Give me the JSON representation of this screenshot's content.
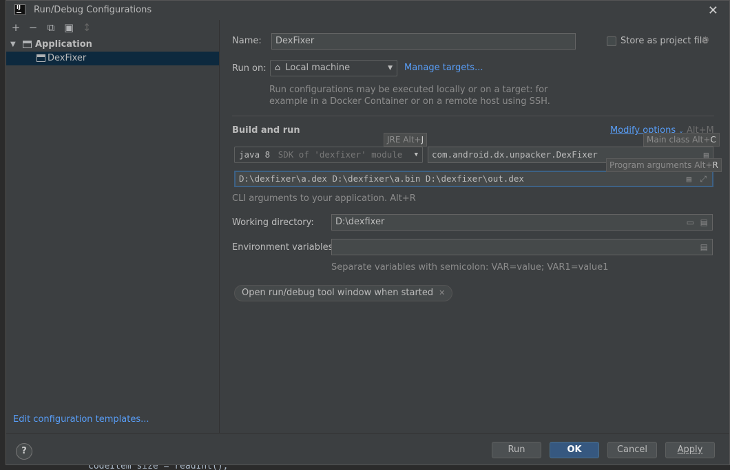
{
  "window": {
    "title": "Run/Debug Configurations"
  },
  "background": {
    "code_line": "codeItem_size = readInt();"
  },
  "toolbar": {
    "add": "+",
    "remove": "−",
    "copy": "⧉",
    "move_to_folder": "▣",
    "sort": "↕"
  },
  "tree": {
    "group_label": "Application",
    "item_label": "DexFixer"
  },
  "edit_templates_link": "Edit configuration templates...",
  "form": {
    "name_label": "Name:",
    "name_value": "DexFixer",
    "store_label": "Store as project file",
    "run_on_label": "Run on:",
    "run_on_value": "Local machine",
    "manage_targets": "Manage targets...",
    "run_on_hint_line1": "Run configurations may be executed locally or on a target: for",
    "run_on_hint_line2": "example in a Docker Container or on a remote host using SSH.",
    "section_title": "Build and run",
    "modify_options": "Modify options",
    "modify_options_shortcut": "Alt+M",
    "jre_tooltip_prefix": "JRE Alt+",
    "jre_tooltip_key": "J",
    "jre_value": "java 8",
    "jre_hint": "SDK of 'dexfixer' module",
    "main_class_tooltip_prefix": "Main class Alt+",
    "main_class_tooltip_key": "C",
    "main_class_value": "com.android.dx.unpacker.DexFixer",
    "program_args_tooltip_prefix": "Program arguments Alt+",
    "program_args_tooltip_key": "R",
    "program_args_value": "D:\\dexfixer\\a.dex D:\\dexfixer\\a.bin D:\\dexfixer\\out.dex",
    "cli_hint": "CLI arguments to your application. Alt+R",
    "working_dir_label": "Working directory:",
    "working_dir_value": "D:\\dexfixer",
    "env_label": "Environment variables:",
    "env_value": "",
    "env_hint": "Separate variables with semicolon: VAR=value; VAR1=value1",
    "chip_label": "Open run/debug tool window when started"
  },
  "buttons": {
    "help": "?",
    "run": "Run",
    "ok": "OK",
    "cancel": "Cancel",
    "apply": "Apply"
  }
}
